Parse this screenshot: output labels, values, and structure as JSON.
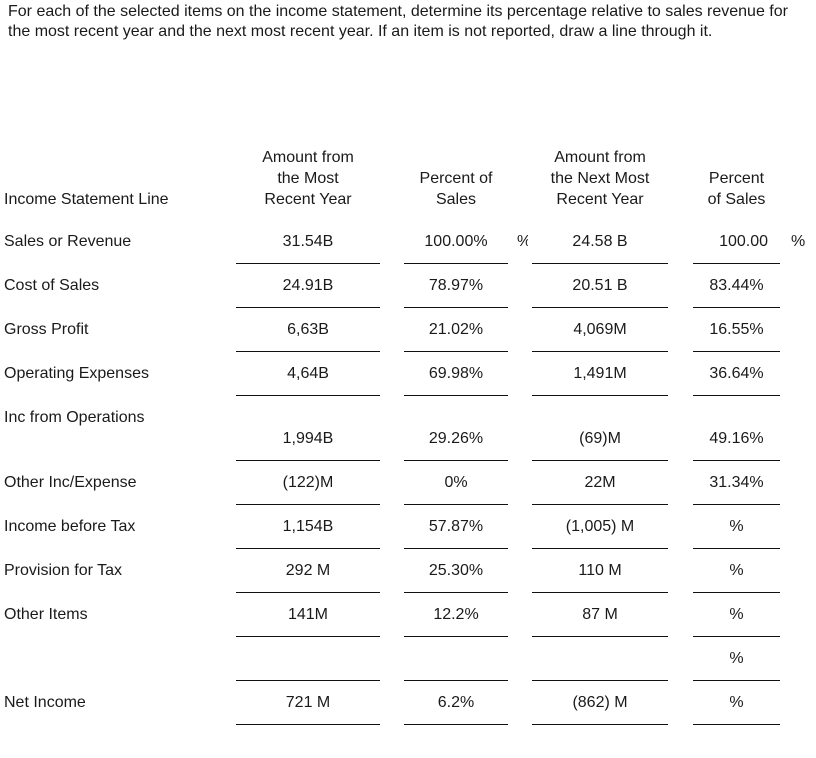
{
  "instructions": "For each of the selected items on the income statement, determine its percentage relative to sales revenue for the most recent year and the next most recent year. If an item is not reported, draw a line through it.",
  "headers": {
    "line": "Income Statement Line",
    "amount_recent": [
      "Amount from",
      "the Most",
      "Recent Year"
    ],
    "percent_recent": [
      "Percent of",
      "Sales"
    ],
    "amount_next": [
      "Amount from",
      "the Next Most",
      "Recent Year"
    ],
    "percent_next": [
      "Percent",
      "of Sales"
    ]
  },
  "rows": [
    {
      "label": "Sales or Revenue",
      "amount_recent": "31.54B",
      "percent_recent": "100.00%",
      "percent_recent_suffix": "%",
      "amount_next": "24.58 B",
      "percent_next": "100.00",
      "percent_next_suffix": "%"
    },
    {
      "label": "Cost of Sales",
      "amount_recent": "24.91B",
      "percent_recent": "78.97%",
      "amount_next": "20.51 B",
      "percent_next": "83.44%"
    },
    {
      "label": "Gross Profit",
      "amount_recent": "6,63B",
      "percent_recent": "21.02%",
      "amount_next": "4,069M",
      "percent_next": "16.55%"
    },
    {
      "label": "Operating Expenses",
      "amount_recent": "4,64B",
      "percent_recent": "69.98%",
      "amount_next": "1,491M",
      "percent_next": "36.64%"
    },
    {
      "label": "Inc from Operations",
      "amount_recent": "1,994B",
      "percent_recent": "29.26%",
      "amount_next": "(69)M",
      "percent_next": "49.16%"
    },
    {
      "label": "Other Inc/Expense",
      "amount_recent": "(122)M",
      "percent_recent": "0%",
      "amount_next": "22M",
      "percent_next": "31.34%"
    },
    {
      "label": "Income before Tax",
      "amount_recent": "1,154B",
      "percent_recent": "57.87%",
      "amount_next": "(1,005) M",
      "percent_next": "%"
    },
    {
      "label": "Provision for Tax",
      "amount_recent": "292 M",
      "percent_recent": "25.30%",
      "amount_next": "110 M",
      "percent_next": "%"
    },
    {
      "label": "Other Items",
      "amount_recent": "141M",
      "percent_recent": "12.2%",
      "amount_next": "87 M",
      "percent_next": "%"
    },
    {
      "label": "",
      "amount_recent": "",
      "percent_recent": "",
      "amount_next": "",
      "percent_next": "%"
    },
    {
      "label": "Net Income",
      "amount_recent": "721 M",
      "percent_recent": "6.2%",
      "amount_next": "(862) M",
      "percent_next": "%"
    }
  ]
}
